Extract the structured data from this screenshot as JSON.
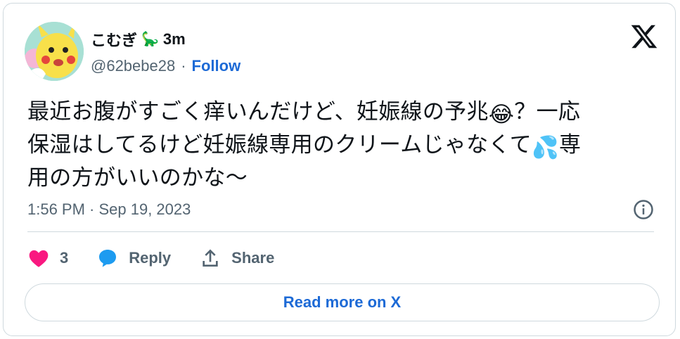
{
  "author": {
    "display_name": "こむぎ",
    "name_emoji": "🦕",
    "time_ago": "3m",
    "handle": "@62bebe28",
    "separator": "·",
    "follow_label": "Follow"
  },
  "tweet": {
    "line1_a": "最近お腹がすごく痒いんだけど、妊娠線の予兆",
    "emoji_1": "😂",
    "line1_b": "？一応",
    "line2_a": "保湿はしてるけど妊娠線専用のクリームじゃなくて",
    "emoji_2": "💦",
    "line2_b": "専",
    "line3": "用の方がいいのかな〜",
    "timestamp": "1:56 PM · Sep 19, 2023"
  },
  "actions": {
    "like_count": "3",
    "reply_label": "Reply",
    "share_label": "Share"
  },
  "read_more_label": "Read more on X",
  "colors": {
    "link": "#1d6ad6",
    "like": "#f91880",
    "reply": "#1d9bf0",
    "muted": "#536471",
    "border": "#cfd9de"
  }
}
